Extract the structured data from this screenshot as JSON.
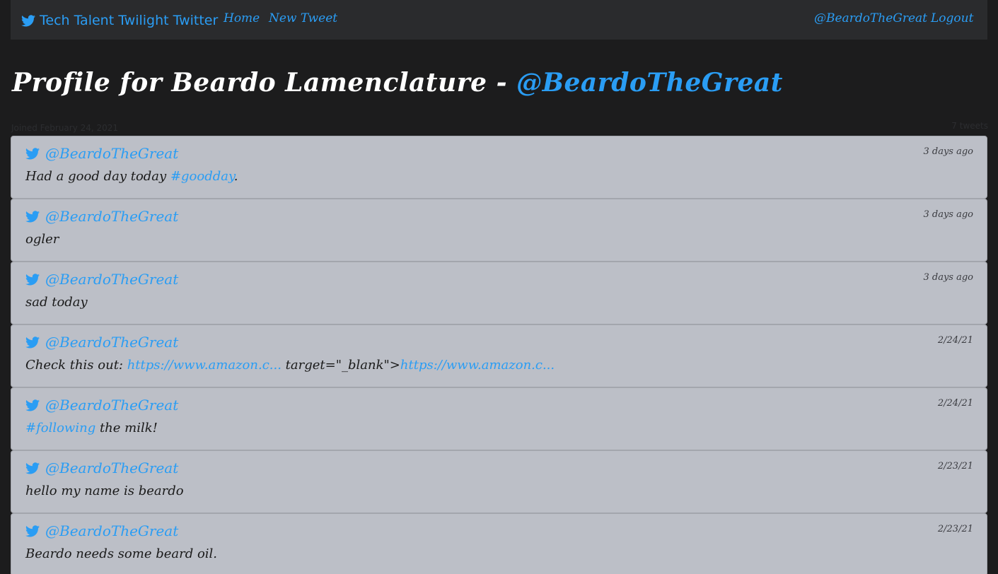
{
  "nav": {
    "brand": "Tech Talent Twilight Twitter",
    "links": [
      "Home",
      "New Tweet"
    ],
    "user": "@BeardoTheGreat",
    "logout": "Logout"
  },
  "profile": {
    "title_prefix": "Profile for Beardo Lamenclature - ",
    "handle": "@BeardoTheGreat",
    "joined": "Joined February 24, 2021",
    "tweet_count": "7 tweets"
  },
  "colors": {
    "accent": "#2a9df4",
    "card": "#bcbfc7",
    "background": "#1c1c1d",
    "navbar": "#2a2b2d"
  },
  "icons": {
    "brand": "twitter-bird-icon",
    "tweet": "twitter-bird-icon"
  },
  "tweets": [
    {
      "handle": "@BeardoTheGreat",
      "time": "3 days ago",
      "parts": [
        {
          "t": "Had a good day today "
        },
        {
          "t": "#goodday",
          "link": true
        },
        {
          "t": "."
        }
      ]
    },
    {
      "handle": "@BeardoTheGreat",
      "time": "3 days ago",
      "parts": [
        {
          "t": "ogler"
        }
      ]
    },
    {
      "handle": "@BeardoTheGreat",
      "time": "3 days ago",
      "parts": [
        {
          "t": "sad today"
        }
      ]
    },
    {
      "handle": "@BeardoTheGreat",
      "time": "2/24/21",
      "parts": [
        {
          "t": "Check this out: "
        },
        {
          "t": "https://www.amazon.c...",
          "link": true
        },
        {
          "t": " target=\"_blank\">"
        },
        {
          "t": "https://www.amazon.c...",
          "link": true
        }
      ]
    },
    {
      "handle": "@BeardoTheGreat",
      "time": "2/24/21",
      "parts": [
        {
          "t": "#following",
          "link": true
        },
        {
          "t": " the milk!"
        }
      ]
    },
    {
      "handle": "@BeardoTheGreat",
      "time": "2/23/21",
      "parts": [
        {
          "t": "hello my name is beardo"
        }
      ]
    },
    {
      "handle": "@BeardoTheGreat",
      "time": "2/23/21",
      "parts": [
        {
          "t": "Beardo needs some beard oil."
        }
      ]
    }
  ]
}
